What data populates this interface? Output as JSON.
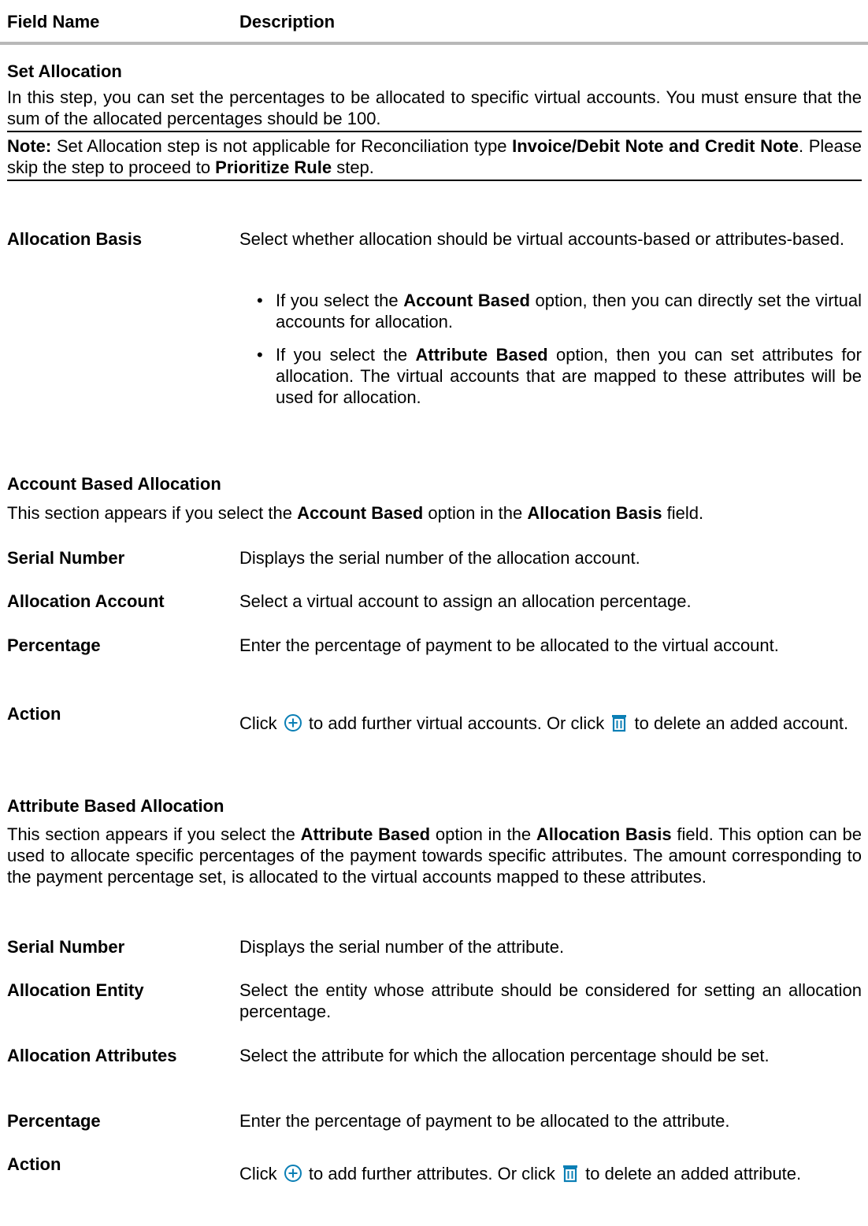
{
  "header": {
    "col1": "Field Name",
    "col2": "Description"
  },
  "set_allocation": {
    "title": "Set Allocation",
    "intro": "In this step, you can set the percentages to be allocated to specific virtual accounts. You must ensure that the sum of the allocated percentages should be 100.",
    "note_label": "Note:",
    "note_t1": " Set Allocation step is not applicable for Reconciliation type ",
    "note_b1": "Invoice/Debit Note and Credit Note",
    "note_t2": ". Please skip the step to proceed to ",
    "note_b2": "Prioritize Rule",
    "note_t3": " step."
  },
  "allocation_basis": {
    "label": "Allocation Basis",
    "desc": "Select whether allocation should be virtual accounts-based or attributes-based.",
    "bullets": [
      {
        "pre": "If you select the ",
        "bold": "Account Based",
        "post": " option, then you can directly set the virtual accounts for allocation."
      },
      {
        "pre": "If you select the ",
        "bold": "Attribute Based",
        "post": " option, then you can set attributes for allocation. The virtual accounts that are mapped to these attributes will be used for allocation."
      }
    ]
  },
  "account_based": {
    "title": "Account Based Allocation",
    "intro_pre": "This section appears if you select the ",
    "intro_b1": "Account Based",
    "intro_mid": " option in the ",
    "intro_b2": "Allocation Basis",
    "intro_post": " field.",
    "fields": [
      {
        "label": "Serial Number",
        "desc": "Displays the serial number of the allocation account."
      },
      {
        "label": "Allocation Account",
        "desc": "Select a virtual account to assign an allocation percentage."
      },
      {
        "label": "Percentage",
        "desc": "Enter the percentage of payment to be allocated to the virtual account."
      }
    ],
    "action": {
      "label": "Action",
      "t1": "Click ",
      "t2": " to add further virtual accounts. Or click ",
      "t3": " to delete an added account."
    }
  },
  "attribute_based": {
    "title": "Attribute Based Allocation",
    "intro_pre": "This section appears if you select the ",
    "intro_b1": "Attribute Based",
    "intro_mid": " option in the ",
    "intro_b2": "Allocation Basis",
    "intro_post": " field. This option can be used to allocate specific percentages of the payment towards specific attributes. The amount corresponding to the payment percentage set, is allocated to the virtual accounts mapped to these attributes.",
    "fields": [
      {
        "label": "Serial Number",
        "desc": "Displays the serial number of the attribute."
      },
      {
        "label": "Allocation Entity",
        "desc": "Select the entity whose attribute should be considered for setting an allocation percentage."
      },
      {
        "label": "Allocation Attributes",
        "desc": "Select the attribute for which the allocation percentage should be set."
      },
      {
        "label": "Percentage",
        "desc": "Enter the percentage of payment to be allocated to the attribute."
      }
    ],
    "action": {
      "label": "Action",
      "t1": "Click ",
      "t2": " to add further attributes. Or click ",
      "t3": " to delete an added attribute."
    }
  },
  "colors": {
    "icon": "#0b7fb5",
    "rule": "#b8b8b8"
  },
  "icons": {
    "add": "add-circle-icon",
    "delete": "trash-icon"
  }
}
